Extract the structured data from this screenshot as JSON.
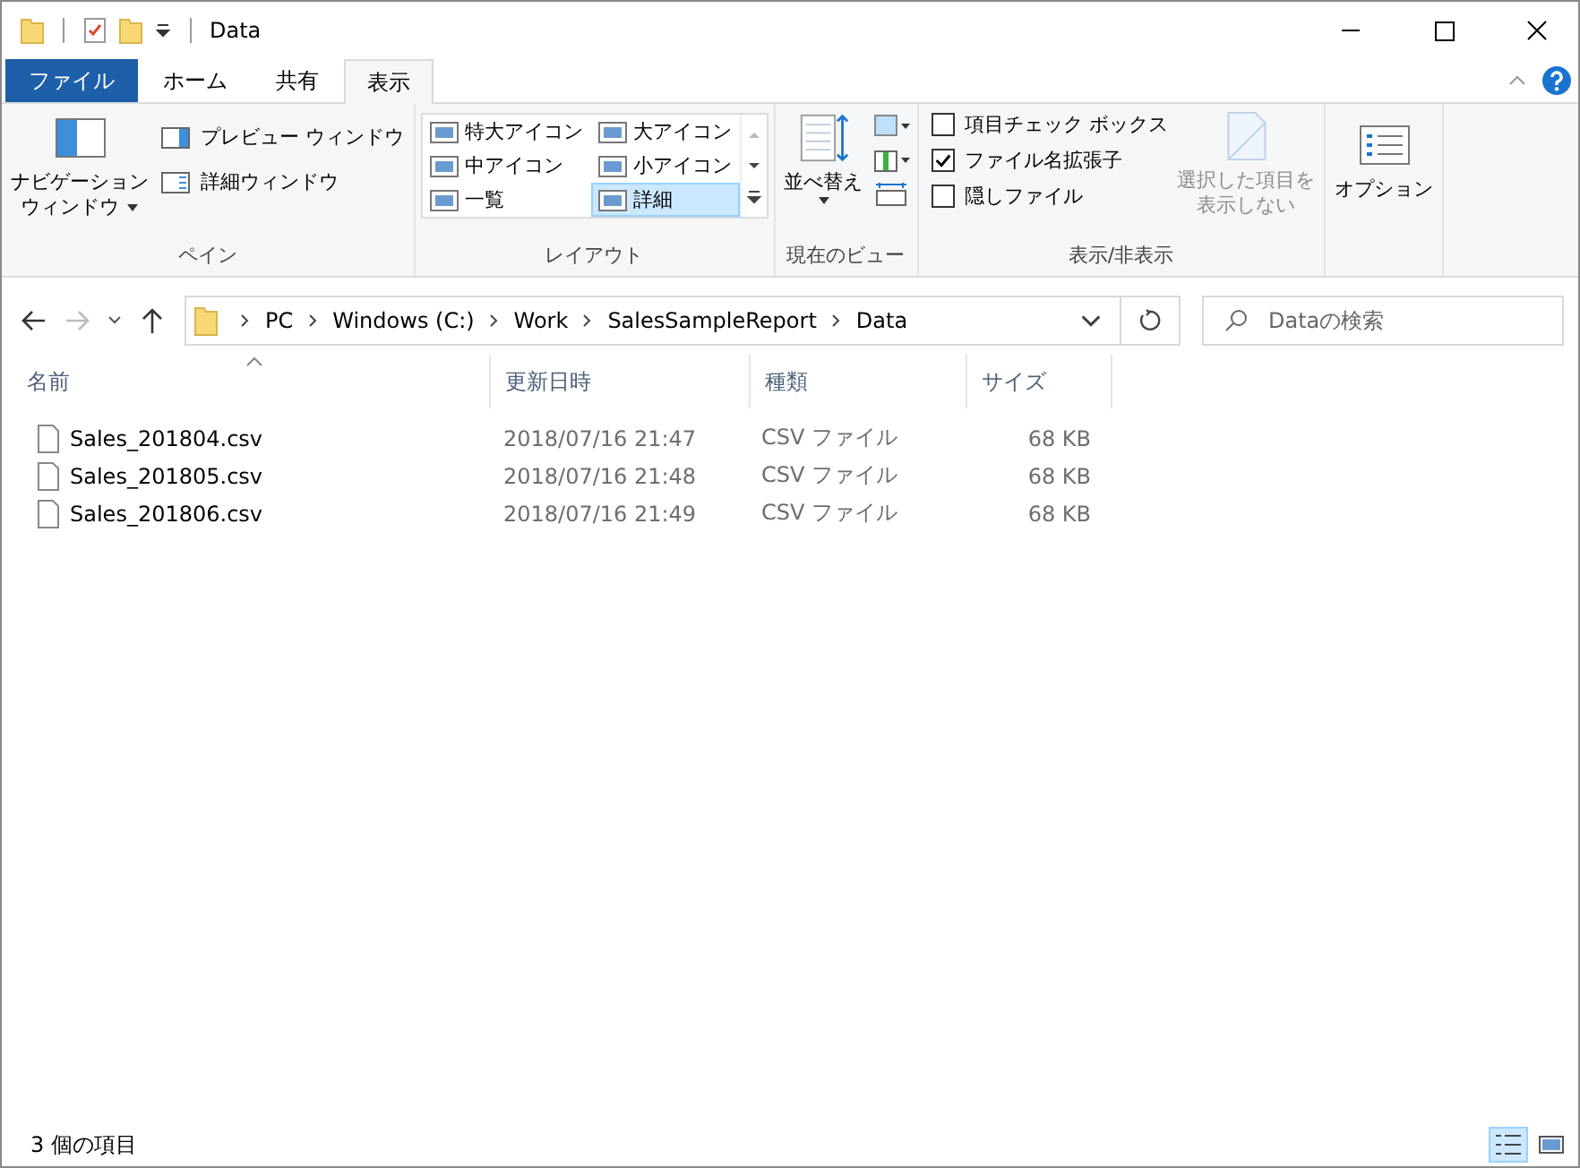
{
  "window": {
    "title": "Data"
  },
  "ribbon_tabs": [
    {
      "label": "ファイル",
      "kind": "file",
      "selected": false
    },
    {
      "label": "ホーム",
      "kind": "tab",
      "selected": false
    },
    {
      "label": "共有",
      "kind": "tab",
      "selected": false
    },
    {
      "label": "表示",
      "kind": "tab",
      "selected": true
    }
  ],
  "pane_group": {
    "navigation_pane": [
      "ナビゲーション",
      "ウィンドウ"
    ],
    "preview_pane": "プレビュー ウィンドウ",
    "details_pane": "詳細ウィンドウ",
    "label": "ペイン"
  },
  "layout_group": {
    "options": [
      {
        "label": "特大アイコン",
        "selected": false
      },
      {
        "label": "大アイコン",
        "selected": false
      },
      {
        "label": "中アイコン",
        "selected": false
      },
      {
        "label": "小アイコン",
        "selected": false
      },
      {
        "label": "一覧",
        "selected": false
      },
      {
        "label": "詳細",
        "selected": true
      }
    ],
    "label": "レイアウト"
  },
  "current_view_group": {
    "sort_by": "並べ替え",
    "label": "現在のビュー"
  },
  "show_hide_group": {
    "checkboxes": [
      {
        "label": "項目チェック ボックス",
        "checked": false
      },
      {
        "label": "ファイル名拡張子",
        "checked": true
      },
      {
        "label": "隠しファイル",
        "checked": false
      }
    ],
    "hide_selected": {
      "lines": [
        "選択した項目を",
        "表示しない"
      ],
      "disabled": true
    },
    "label": "表示/非表示"
  },
  "options_button": "オプション",
  "address_bar": {
    "crumbs": [
      "PC",
      "Windows (C:)",
      "Work",
      "SalesSampleReport",
      "Data"
    ]
  },
  "search": {
    "placeholder": "Dataの検索"
  },
  "table": {
    "columns": [
      "名前",
      "更新日時",
      "種類",
      "サイズ"
    ],
    "rows": [
      {
        "name": "Sales_201804.csv",
        "modified": "2018/07/16 21:47",
        "type": "CSV ファイル",
        "size": "68 KB"
      },
      {
        "name": "Sales_201805.csv",
        "modified": "2018/07/16 21:48",
        "type": "CSV ファイル",
        "size": "68 KB"
      },
      {
        "name": "Sales_201806.csv",
        "modified": "2018/07/16 21:49",
        "type": "CSV ファイル",
        "size": "68 KB"
      }
    ]
  },
  "status_bar": {
    "count": "3 個の項目",
    "view_buttons": [
      {
        "kind": "details",
        "selected": true
      },
      {
        "kind": "large",
        "selected": false
      }
    ]
  }
}
